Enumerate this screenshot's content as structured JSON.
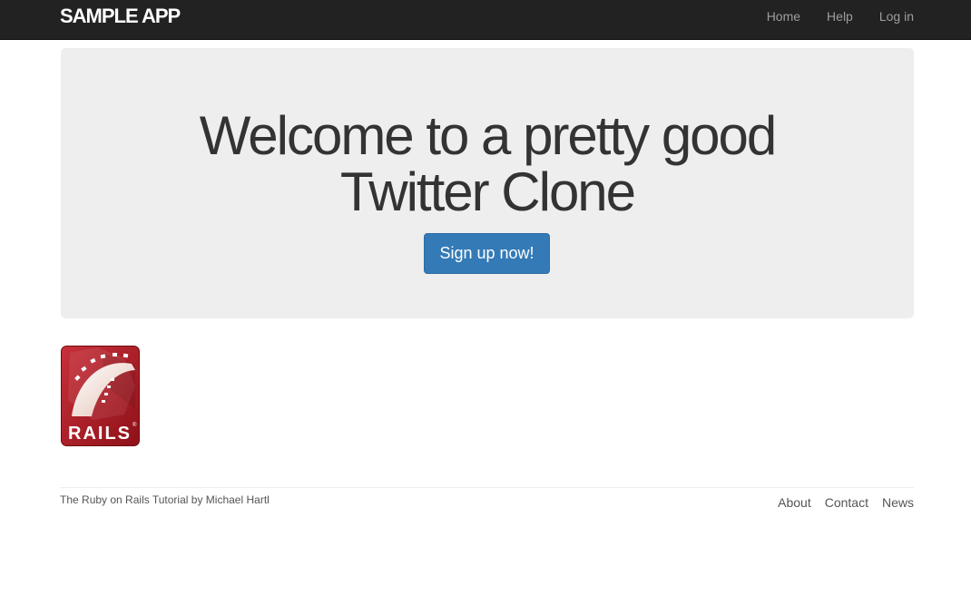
{
  "header": {
    "logo": "SAMPLE APP",
    "nav": [
      "Home",
      "Help",
      "Log in"
    ]
  },
  "hero": {
    "line1": "Welcome to a pretty good",
    "line2": "Twitter Clone",
    "signup_label": "Sign up now!"
  },
  "rails_logo": {
    "text": "RAILS",
    "icon": "rails-logo"
  },
  "footer": {
    "credit_prefix": "The",
    "credit_link": "Ruby on Rails Tutorial",
    "credit_mid": "by",
    "credit_author": "Michael Hartl",
    "links": [
      "About",
      "Contact",
      "News"
    ]
  },
  "colors": {
    "navbar": "#222222",
    "jumbotron": "#eeeeee",
    "primary_button": "#337ab7",
    "rails_red": "#b11f25"
  }
}
